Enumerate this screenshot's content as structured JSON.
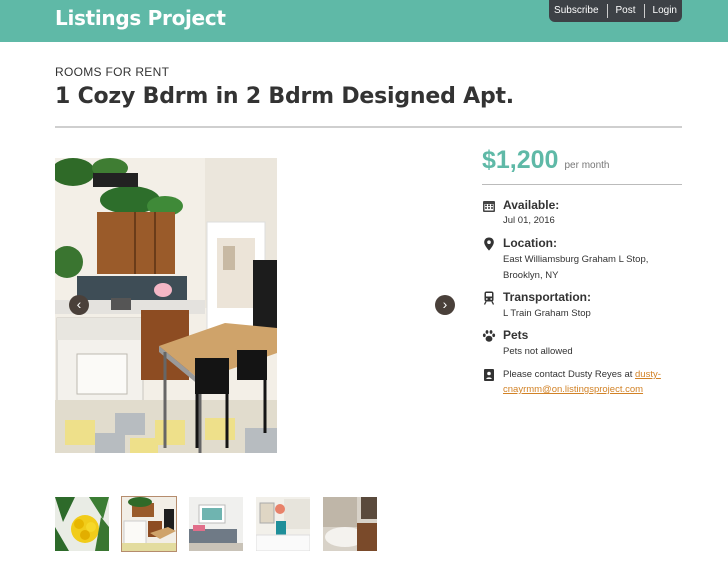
{
  "header": {
    "brand": "Listings Project",
    "nav": {
      "subscribe": "Subscribe",
      "post": "Post",
      "login": "Login"
    }
  },
  "listing": {
    "category": "ROOMS FOR RENT",
    "title": "1 Cozy Bdrm in 2 Bdrm Designed Apt.",
    "price": "$1,200",
    "price_unit": "per month",
    "available_label": "Available:",
    "available_value": "Jul 01, 2016",
    "location_label": "Location:",
    "location_line1": "East Williamsburg Graham L Stop,",
    "location_line2": "Brooklyn, NY",
    "transport_label": "Transportation:",
    "transport_value": "L Train Graham Stop",
    "pets_label": "Pets",
    "pets_value": "Pets not allowed",
    "contact_prefix": "Please contact Dusty Reyes at ",
    "contact_email_line1": "dusty-",
    "contact_email_line2": "cnayrmm@on.listingsproject.com"
  },
  "gallery": {
    "prev_glyph": "‹",
    "next_glyph": "›",
    "selected_index": 1,
    "thumbnail_count": 5
  },
  "colors": {
    "accent": "#5fb9a7",
    "nav_bg": "#3d4146",
    "link": "#d28226"
  }
}
